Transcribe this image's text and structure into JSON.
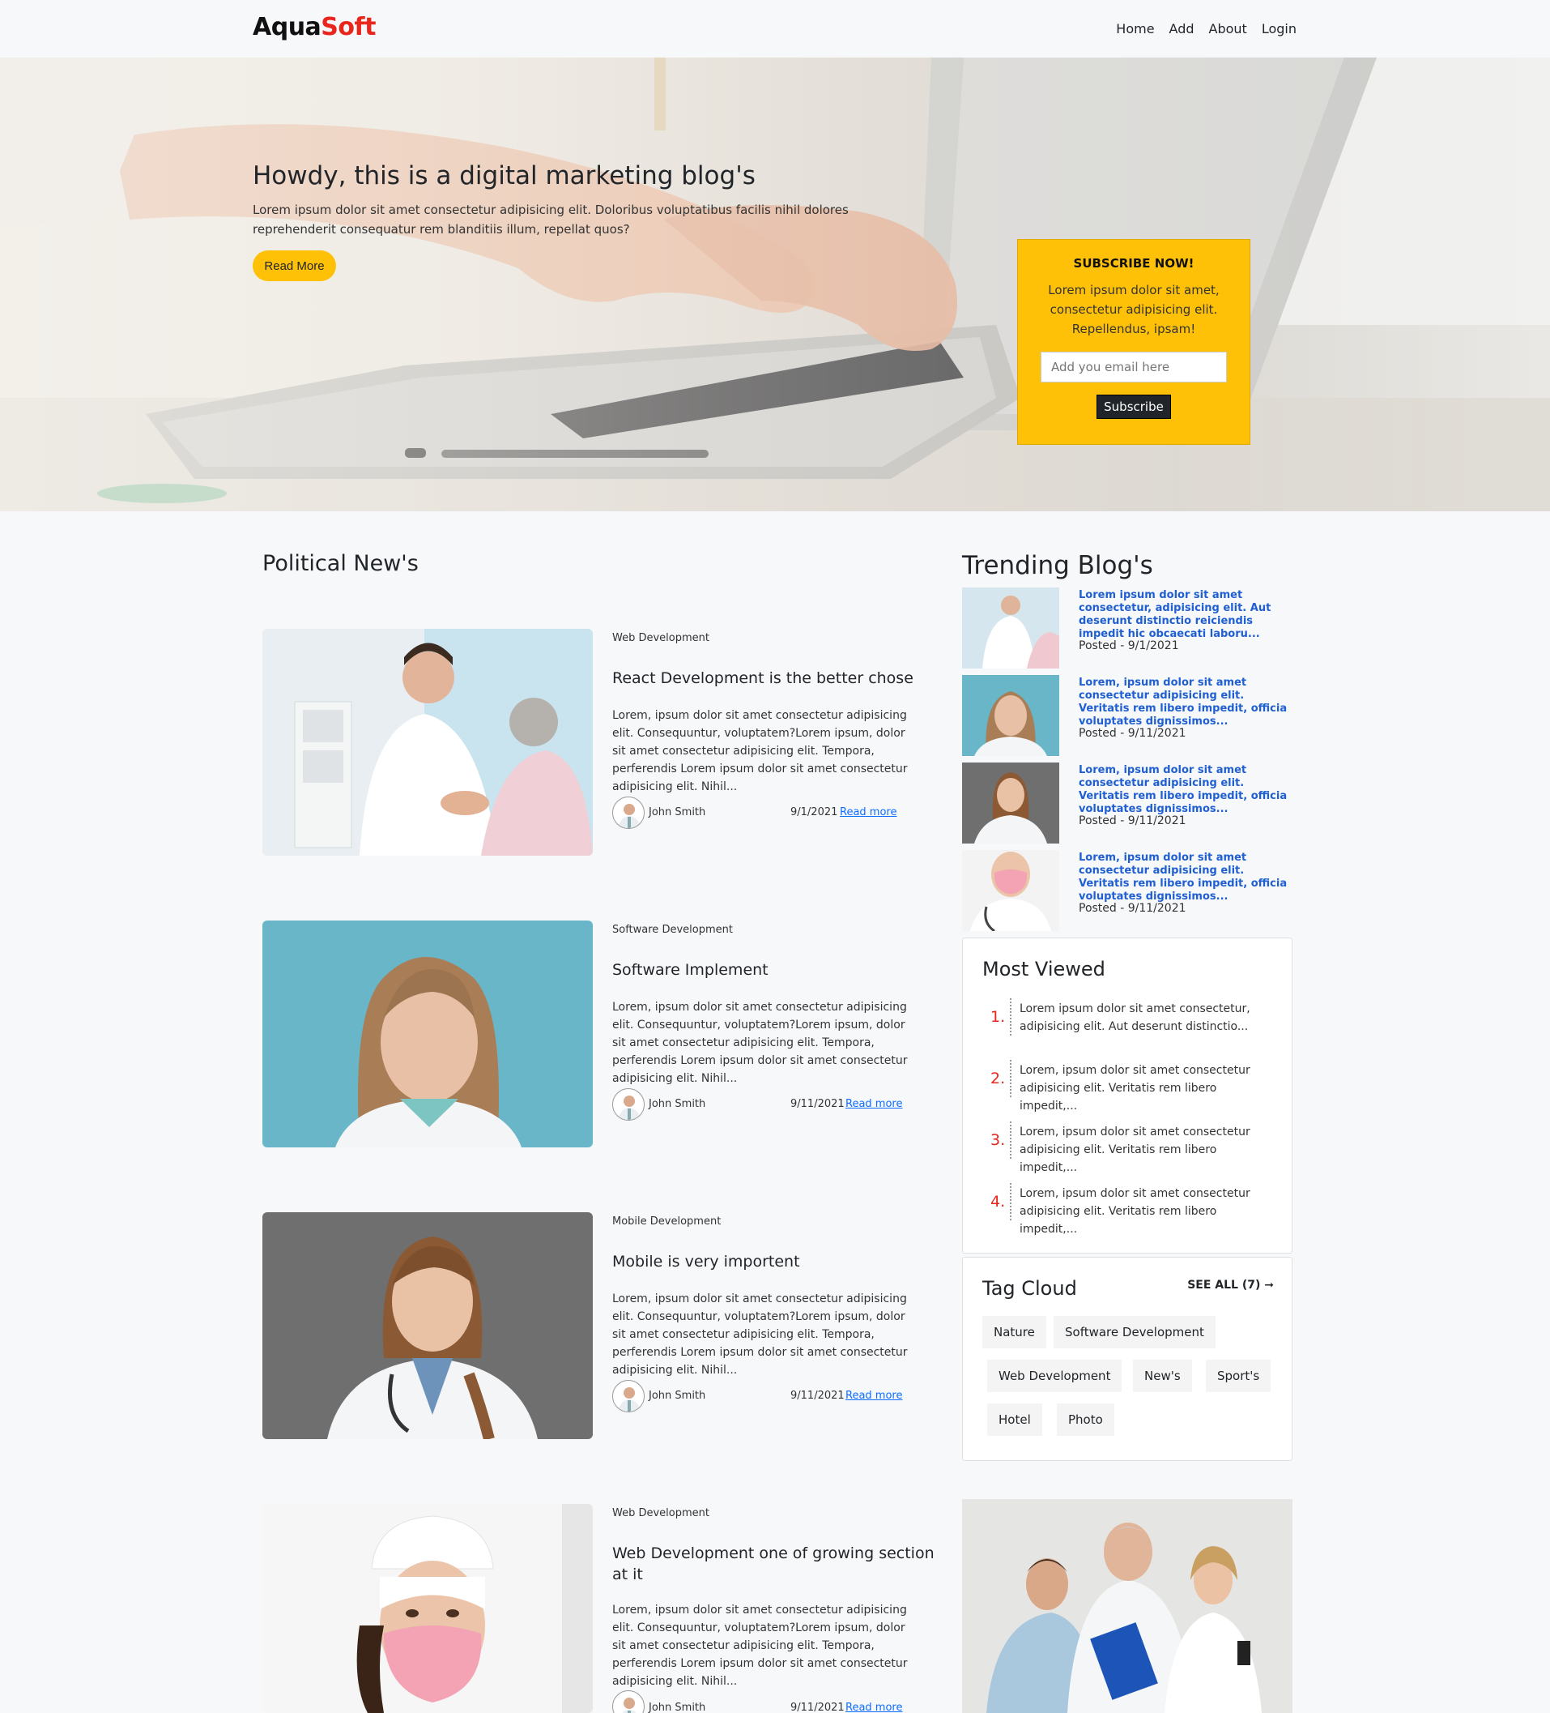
{
  "brand": {
    "part1": "Aqua",
    "part2": "Soft"
  },
  "nav": {
    "items": [
      "Home",
      "Add",
      "About",
      "Login"
    ]
  },
  "hero": {
    "title": "Howdy, this is a digital marketing blog's",
    "text": "Lorem ipsum dolor sit amet consectetur adipisicing elit. Doloribus voluptatibus facilis nihil dolores reprehenderit consequatur rem blanditiis illum, repellat quos?",
    "button": "Read More"
  },
  "subscribe": {
    "title": "SUBSCRIBE NOW!",
    "text": "Lorem ipsum dolor sit amet, consectetur adipisicing elit. Repellendus, ipsam!",
    "placeholder": "Add you email here",
    "button": "Subscribe"
  },
  "posts_section": {
    "title": "Political New's"
  },
  "posts": [
    {
      "category": "Web Development",
      "title": "React Development is the better chose",
      "excerpt": "Lorem, ipsum dolor sit amet consectetur adipisicing elit. Consequuntur, voluptatem?Lorem ipsum, dolor sit amet consectetur adipisicing elit. Tempora, perferendis Lorem ipsum dolor sit amet consectetur adipisicing elit. Nihil...",
      "author": "John Smith",
      "date": "9/1/2021",
      "read_more": "Read more"
    },
    {
      "category": "Software Development",
      "title": "Software Implement",
      "excerpt": "Lorem, ipsum dolor sit amet consectetur adipisicing elit. Consequuntur, voluptatem?Lorem ipsum, dolor sit amet consectetur adipisicing elit. Tempora, perferendis Lorem ipsum dolor sit amet consectetur adipisicing elit. Nihil...",
      "author": "John Smith",
      "date": "9/11/2021",
      "read_more": "Read more"
    },
    {
      "category": "Mobile Development",
      "title": "Mobile is very importent",
      "excerpt": "Lorem, ipsum dolor sit amet consectetur adipisicing elit. Consequuntur, voluptatem?Lorem ipsum, dolor sit amet consectetur adipisicing elit. Tempora, perferendis Lorem ipsum dolor sit amet consectetur adipisicing elit. Nihil...",
      "author": "John Smith",
      "date": "9/11/2021",
      "read_more": "Read more"
    },
    {
      "category": "Web Development",
      "title": "Web Development one of growing section at it",
      "excerpt": "Lorem, ipsum dolor sit amet consectetur adipisicing elit. Consequuntur, voluptatem?Lorem ipsum, dolor sit amet consectetur adipisicing elit. Tempora, perferendis Lorem ipsum dolor sit amet consectetur adipisicing elit. Nihil...",
      "author": "John Smith",
      "date": "9/11/2021",
      "read_more": "Read more"
    }
  ],
  "trending": {
    "title": "Trending Blog's",
    "items": [
      {
        "text": "Lorem ipsum dolor sit amet consectetur, adipisicing elit. Aut deserunt distinctio reiciendis impedit hic obcaecati laboru...",
        "posted": "Posted - 9/1/2021"
      },
      {
        "text": "Lorem, ipsum dolor sit amet consectetur adipisicing elit. Veritatis rem libero impedit, officia voluptates dignissimos...",
        "posted": "Posted - 9/11/2021"
      },
      {
        "text": "Lorem, ipsum dolor sit amet consectetur adipisicing elit. Veritatis rem libero impedit, officia voluptates dignissimos...",
        "posted": "Posted - 9/11/2021"
      },
      {
        "text": "Lorem, ipsum dolor sit amet consectetur adipisicing elit. Veritatis rem libero impedit, officia voluptates dignissimos...",
        "posted": "Posted - 9/11/2021"
      }
    ]
  },
  "most_viewed": {
    "title": "Most Viewed",
    "items": [
      {
        "num": "1.",
        "text": "Lorem ipsum dolor sit amet consectetur, adipisicing elit. Aut deserunt distinctio..."
      },
      {
        "num": "2.",
        "text": "Lorem, ipsum dolor sit amet consectetur adipisicing elit. Veritatis rem libero impedit,..."
      },
      {
        "num": "3.",
        "text": "Lorem, ipsum dolor sit amet consectetur adipisicing elit. Veritatis rem libero impedit,..."
      },
      {
        "num": "4.",
        "text": "Lorem, ipsum dolor sit amet consectetur adipisicing elit. Veritatis rem libero impedit,..."
      }
    ]
  },
  "tag_cloud": {
    "title": "Tag Cloud",
    "see_all": "SEE ALL (7) ➞",
    "tags": [
      "Nature",
      "Software Development",
      "Web Development",
      "New's",
      "Sport's",
      "Hotel",
      "Photo"
    ]
  },
  "colors": {
    "accent": "#ffc107",
    "brand_red": "#e8261c",
    "link_blue": "#0d6efd",
    "trend_blue": "#1f5fd1"
  },
  "icons": {
    "arrow": "arrow-right-icon"
  }
}
